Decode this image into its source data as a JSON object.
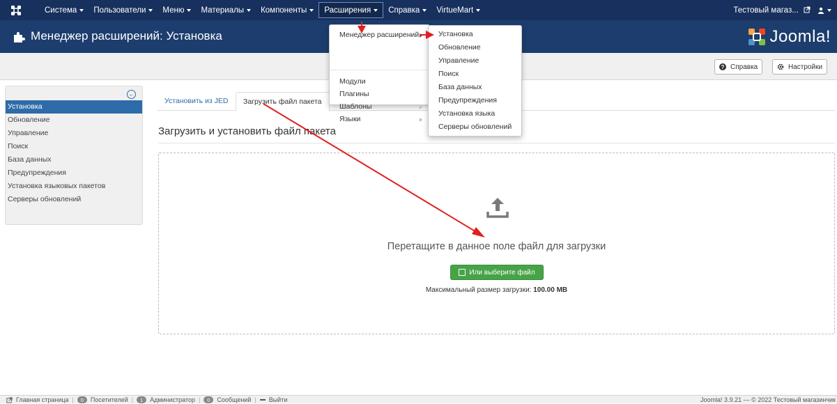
{
  "topnav": {
    "menu": [
      "Система",
      "Пользователи",
      "Меню",
      "Материалы",
      "Компоненты",
      "Расширения",
      "Справка",
      "VirtueMart"
    ],
    "site_name": "Тестовый магаз..."
  },
  "titlebar": {
    "title": "Менеджер расширений: Установка",
    "brand": "Joomla!"
  },
  "toolbar": {
    "help": "Справка",
    "options": "Настройки"
  },
  "sidebar": {
    "items": [
      "Установка",
      "Обновление",
      "Управление",
      "Поиск",
      "База данных",
      "Предупреждения",
      "Установка языковых пакетов",
      "Серверы обновлений"
    ]
  },
  "tabs": [
    "Установить из JED",
    "Загрузить файл пакета"
  ],
  "content": {
    "section_title": "Загрузить и установить файл пакета",
    "drop_text": "Перетащите в данное поле файл для загрузки",
    "choose_button": "Или выберите файл",
    "max_size_label": "Максимальный размер загрузки:",
    "max_size_value": "100.00 MB"
  },
  "extensions_menu": {
    "items": [
      "Менеджер расширений",
      "Модули",
      "Плагины",
      "Шаблоны",
      "Языки"
    ]
  },
  "manager_submenu": {
    "items": [
      "Установка",
      "Обновление",
      "Управление",
      "Поиск",
      "База данных",
      "Предупреждения",
      "Установка языка",
      "Серверы обновлений"
    ]
  },
  "footer": {
    "home": "Главная страница",
    "visitors_count": "0",
    "visitors": "Посетителей",
    "admins_count": "1",
    "admins": "Администратор",
    "messages_count": "0",
    "messages": "Сообщений",
    "logout": "Выйти",
    "copyright": "Joomla! 3.9.21 — © 2022 Тестовый магазинчик"
  },
  "colors": {
    "topnav_bg": "#17305d",
    "titlebar_bg": "#1c3d6e",
    "accent": "#2d6ca8",
    "success": "#47a347",
    "annotation": "#e02020"
  }
}
